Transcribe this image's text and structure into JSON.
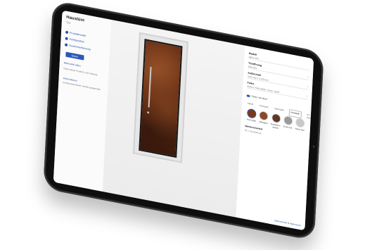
{
  "app": {
    "brand": "Haustüre",
    "subtitle": "Typ",
    "steps": [
      {
        "label": "Produktmodell"
      },
      {
        "label": "Konfiguration"
      },
      {
        "label": "Zusammenfassung"
      }
    ],
    "primary_button": "Weiter",
    "link_notes": "Merkzettel teilen",
    "checkbox_note": "Daten dieser Produkt in der Website",
    "side_info_title": "Informationen",
    "side_info_text": "Konfigurationsdaten werden gespeichert"
  },
  "panel": {
    "fields": [
      {
        "label": "Modell",
        "value": "Alpha 100"
      },
      {
        "label": "Türöffnung",
        "value": "DIN links"
      },
      {
        "label": "Außenmaß",
        "value": "1100 mm x 2150 mm"
      },
      {
        "label": "Farbe",
        "value": "Außen: Rost Optik / Innen: Weiß"
      }
    ],
    "toggle_label": "Farbe: identisch",
    "tabs": [
      "Metall",
      "Holzoptik",
      "Steinoptik",
      "Rostoptik",
      "Uni matt/Glanz"
    ],
    "active_tab": 3,
    "swatches": [
      {
        "name": "Rost Optik",
        "color": "#7a3a18"
      },
      {
        "name": "Mahagoni",
        "color": "#8a4a2a"
      },
      {
        "name": "Nussbaum dunkel",
        "color": "#5e3a26"
      },
      {
        "name": "Eiche hell",
        "color": "#9a9a9a"
      },
      {
        "name": "Beton hell",
        "color": "#c9c9c9"
      }
    ],
    "sub_label": "Wetterschenkel",
    "sub_value": "RC 2 Ausstattung",
    "footer_link": "Datenschutz & Impressum"
  },
  "colors": {
    "accent": "#2b57b9",
    "door_primary": "#6b3217",
    "bezel": "#1d1d1f"
  }
}
